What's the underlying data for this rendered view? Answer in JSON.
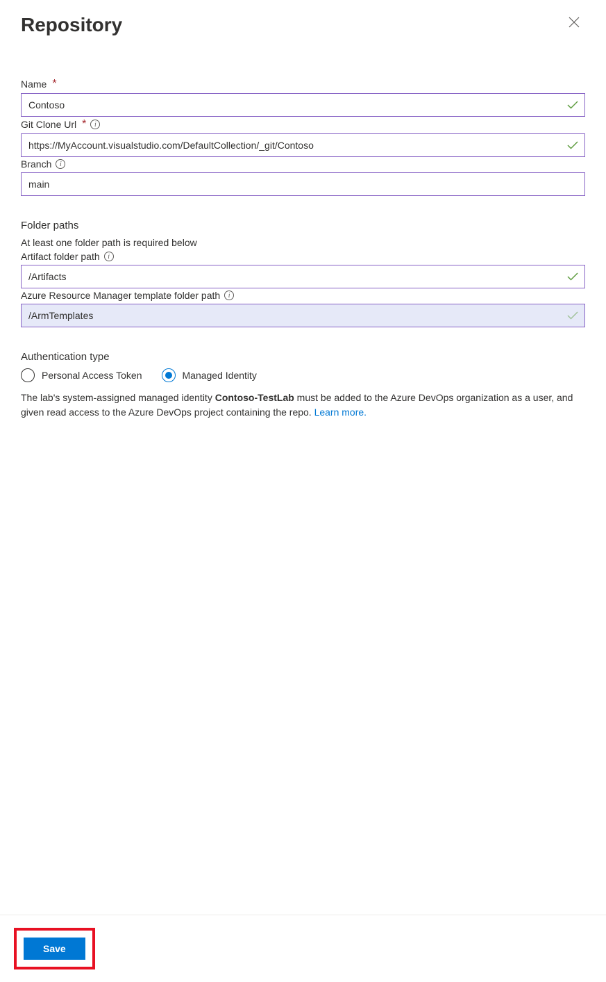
{
  "header": {
    "title": "Repository"
  },
  "fields": {
    "name": {
      "label": "Name",
      "value": "Contoso"
    },
    "gitCloneUrl": {
      "label": "Git Clone Url",
      "value": "https://MyAccount.visualstudio.com/DefaultCollection/_git/Contoso"
    },
    "branch": {
      "label": "Branch",
      "value": "main"
    }
  },
  "folderPaths": {
    "title": "Folder paths",
    "helper": "At least one folder path is required below",
    "artifact": {
      "label": "Artifact folder path",
      "value": "/Artifacts"
    },
    "armTemplate": {
      "label": "Azure Resource Manager template folder path",
      "value": "/ArmTemplates"
    }
  },
  "auth": {
    "title": "Authentication type",
    "options": {
      "pat": "Personal Access Token",
      "mi": "Managed Identity"
    },
    "desc_prefix": "The lab's system-assigned managed identity ",
    "desc_bold": "Contoso-TestLab",
    "desc_suffix": " must be added to the Azure DevOps organization as a user, and given read access to the Azure DevOps project containing the repo. ",
    "learn_more": "Learn more."
  },
  "footer": {
    "save": "Save"
  }
}
